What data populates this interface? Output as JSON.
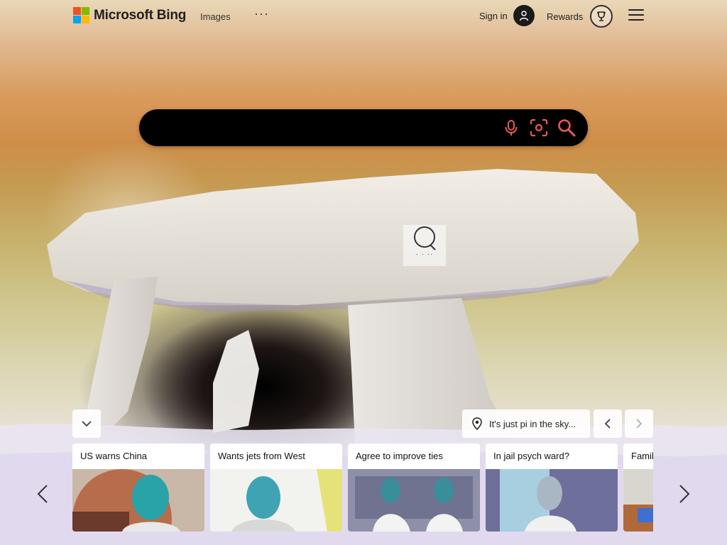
{
  "header": {
    "logo_bold": "Microsoft Bing",
    "nav_images": "Images",
    "nav_more": "···",
    "signin_label": "Sign in",
    "rewards_label": "Rewards"
  },
  "search": {
    "placeholder": "",
    "value": ""
  },
  "visual_search": {
    "dots": "· · ··"
  },
  "image_caption": {
    "text": "It's just pi in the sky..."
  },
  "news_cards": [
    {
      "title": "US warns China"
    },
    {
      "title": "Wants jets from West"
    },
    {
      "title": "Agree to improve ties"
    },
    {
      "title": "In jail psych ward?"
    },
    {
      "title": "Family"
    }
  ],
  "colors": {
    "logo_red": "#f25022",
    "logo_green": "#7fba00",
    "logo_blue": "#00a4ef",
    "logo_yellow": "#ffb900",
    "search_icon_accent": "#e85a5a",
    "search_bar_bg": "#000000"
  },
  "icons": {
    "mic": "microphone-icon",
    "visual": "visual-search-icon",
    "search": "magnifier-icon",
    "location": "location-pin-icon",
    "trophy": "trophy-icon",
    "user": "user-icon",
    "menu": "hamburger-menu-icon"
  }
}
